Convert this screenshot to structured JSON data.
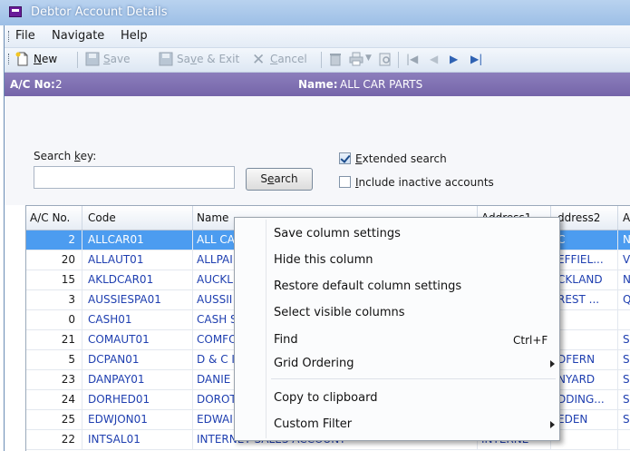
{
  "window": {
    "title": "Debtor Account Details"
  },
  "menubar": {
    "items": [
      "File",
      "Navigate",
      "Help"
    ]
  },
  "toolbar": {
    "new": {
      "prefix": "",
      "ul": "N",
      "rest": "ew"
    },
    "save": {
      "prefix": "",
      "ul": "S",
      "rest": "ave"
    },
    "save_exit": {
      "prefix": "Sa",
      "ul": "v",
      "rest": "e & Exit"
    },
    "cancel": {
      "prefix": "",
      "ul": "C",
      "rest": "ancel"
    }
  },
  "account": {
    "ac_label": "A/C No:",
    "ac_value": "2",
    "name_label": "Name:",
    "name_value": "ALL CAR PARTS"
  },
  "search": {
    "key_prefix": "Search ",
    "key_ul": "k",
    "key_rest": "ey:",
    "value": "",
    "button_prefix": "S",
    "button_ul": "e",
    "button_rest": "arch",
    "extended": {
      "prefix": "",
      "ul": "E",
      "rest": "xtended search",
      "checked": true
    },
    "inactive": {
      "prefix": "",
      "ul": "I",
      "rest": "nclude inactive accounts",
      "checked": false
    }
  },
  "grid": {
    "headers": [
      "A/C No.",
      "Code",
      "Name",
      "Address1",
      "Address2",
      "A"
    ],
    "header_partial": [
      "",
      "",
      "",
      "Address1",
      "ddress2",
      "A"
    ],
    "rows": [
      {
        "ac": "2",
        "code": "ALLCAR01",
        "name": "ALL CA",
        "addr1": "",
        "addr2": "C",
        "a": "N",
        "selected": true
      },
      {
        "ac": "20",
        "code": "ALLAUT01",
        "name": "ALLPAI",
        "addr1": "",
        "addr2": "EFFIEL...",
        "a": "V",
        "selected": false
      },
      {
        "ac": "15",
        "code": "AKLDCAR01",
        "name": "AUCKL",
        "addr1": "",
        "addr2": "CKLAND",
        "a": "N",
        "selected": false
      },
      {
        "ac": "3",
        "code": "AUSSIESPA01",
        "name": "AUSSII",
        "addr1": "",
        "addr2": "REST ...",
        "a": "Q",
        "selected": false
      },
      {
        "ac": "0",
        "code": "CASH01",
        "name": "CASH S",
        "addr1": "",
        "addr2": "",
        "a": "",
        "selected": false
      },
      {
        "ac": "21",
        "code": "COMAUT01",
        "name": "COMFO",
        "addr1": "",
        "addr2": "",
        "a": "S",
        "selected": false
      },
      {
        "ac": "5",
        "code": "DCPAN01",
        "name": "D & C I",
        "addr1": "",
        "addr2": "DFERN",
        "a": "S",
        "selected": false
      },
      {
        "ac": "23",
        "code": "DANPAY01",
        "name": "DANIE",
        "addr1": "",
        "addr2": "NYARD",
        "a": "S",
        "selected": false
      },
      {
        "ac": "24",
        "code": "DORHED01",
        "name": "DOROT",
        "addr1": "",
        "addr2": "DDING...",
        "a": "S",
        "selected": false
      },
      {
        "ac": "25",
        "code": "EDWJON01",
        "name": "EDWAI",
        "addr1": "",
        "addr2": "EDEN",
        "a": "S",
        "selected": false
      },
      {
        "ac": "22",
        "code": "INTSAL01",
        "name": "INTERNET SALES ACCOUNT",
        "addr1": "INTERNE",
        "addr2": "",
        "a": "",
        "selected": false
      }
    ]
  },
  "context_menu": {
    "items": [
      {
        "label": "Save column settings",
        "shortcut": "",
        "submenu": false
      },
      {
        "label": "Hide this column",
        "shortcut": "",
        "submenu": false
      },
      {
        "label": "Restore default column settings",
        "shortcut": "",
        "submenu": false
      },
      {
        "label": "Select visible columns",
        "shortcut": "",
        "submenu": false
      },
      {
        "label": "Find",
        "shortcut": "Ctrl+F",
        "submenu": false
      },
      {
        "label": "Grid Ordering",
        "shortcut": "",
        "submenu": true
      },
      {
        "label": "Copy to clipboard",
        "shortcut": "",
        "submenu": false
      },
      {
        "label": "Custom Filter",
        "shortcut": "",
        "submenu": true
      }
    ]
  },
  "colors": {
    "accent_bar": "#7a6bb0",
    "selection": "#4c9cf0",
    "link_text": "#1f3fb0"
  }
}
